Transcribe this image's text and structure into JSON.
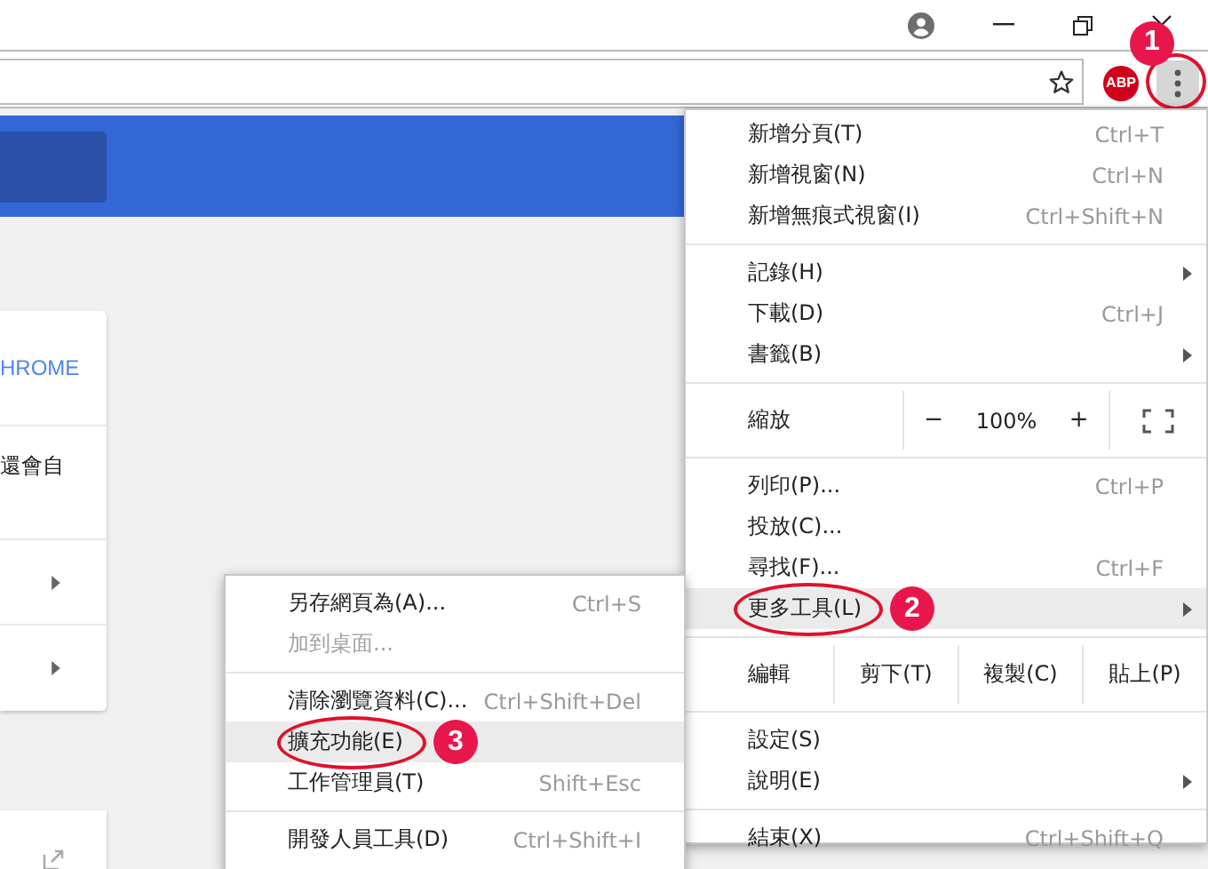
{
  "toolbar": {
    "extension_badge": "ABP",
    "menu_button": {
      "annotation": "1"
    }
  },
  "page": {
    "card": {
      "link": "HROME",
      "text": "還會自"
    }
  },
  "menu": {
    "items": [
      {
        "kind": "item",
        "label": "新增分頁(T)",
        "shortcut": "Ctrl+T",
        "submenu": false,
        "selected": false
      },
      {
        "kind": "item",
        "label": "新增視窗(N)",
        "shortcut": "Ctrl+N",
        "submenu": false,
        "selected": false
      },
      {
        "kind": "item",
        "label": "新增無痕式視窗(I)",
        "shortcut": "Ctrl+Shift+N",
        "submenu": false,
        "selected": false
      },
      {
        "kind": "separator"
      },
      {
        "kind": "item",
        "label": "記錄(H)",
        "submenu": true,
        "selected": false
      },
      {
        "kind": "item",
        "label": "下載(D)",
        "shortcut": "Ctrl+J",
        "submenu": false,
        "selected": false
      },
      {
        "kind": "item",
        "label": "書籤(B)",
        "submenu": true,
        "selected": false
      },
      {
        "kind": "separator"
      },
      {
        "kind": "zoom",
        "label": "縮放",
        "minus": "−",
        "value": "100%",
        "plus": "+"
      },
      {
        "kind": "separator"
      },
      {
        "kind": "item",
        "label": "列印(P)...",
        "shortcut": "Ctrl+P",
        "submenu": false,
        "selected": false
      },
      {
        "kind": "item",
        "label": "投放(C)...",
        "submenu": false,
        "selected": false
      },
      {
        "kind": "item",
        "label": "尋找(F)...",
        "shortcut": "Ctrl+F",
        "submenu": false,
        "selected": false
      },
      {
        "kind": "item",
        "label": "更多工具(L)",
        "submenu": true,
        "selected": true,
        "annotation": "2"
      },
      {
        "kind": "separator"
      },
      {
        "kind": "edit",
        "label": "編輯",
        "actions": [
          "剪下(T)",
          "複製(C)",
          "貼上(P)"
        ]
      },
      {
        "kind": "separator"
      },
      {
        "kind": "item",
        "label": "設定(S)",
        "submenu": false,
        "selected": false
      },
      {
        "kind": "item",
        "label": "說明(E)",
        "submenu": true,
        "selected": false
      },
      {
        "kind": "separator"
      },
      {
        "kind": "item",
        "label": "結束(X)",
        "shortcut": "Ctrl+Shift+Q",
        "submenu": false,
        "selected": false
      }
    ]
  },
  "submenu": {
    "items": [
      {
        "kind": "item",
        "label": "另存網頁為(A)...",
        "shortcut": "Ctrl+S",
        "disabled": false,
        "selected": false
      },
      {
        "kind": "item",
        "label": "加到桌面...",
        "disabled": true,
        "selected": false
      },
      {
        "kind": "separator"
      },
      {
        "kind": "item",
        "label": "清除瀏覽資料(C)...",
        "shortcut": "Ctrl+Shift+Del",
        "disabled": false,
        "selected": false
      },
      {
        "kind": "item",
        "label": "擴充功能(E)",
        "disabled": false,
        "selected": true,
        "annotation": "3"
      },
      {
        "kind": "item",
        "label": "工作管理員(T)",
        "shortcut": "Shift+Esc",
        "disabled": false,
        "selected": false
      },
      {
        "kind": "separator"
      },
      {
        "kind": "item",
        "label": "開發人員工具(D)",
        "shortcut": "Ctrl+Shift+I",
        "disabled": false,
        "selected": false
      }
    ]
  }
}
